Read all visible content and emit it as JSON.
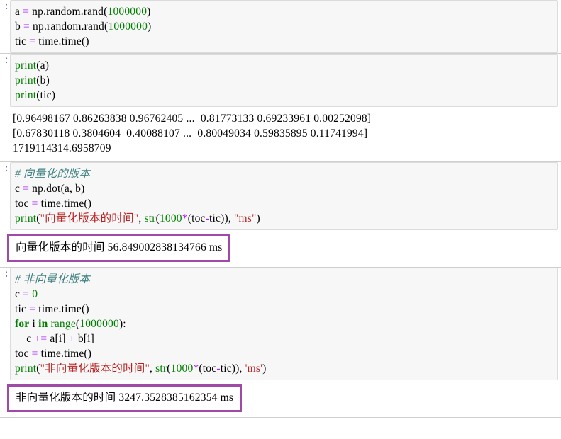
{
  "notebook": {
    "cells": [
      {
        "type": "code",
        "prompt": ":",
        "lines": [
          [
            {
              "t": "a ",
              "c": "plain"
            },
            {
              "t": "=",
              "c": "op"
            },
            {
              "t": " np.random.rand(",
              "c": "plain"
            },
            {
              "t": "1000000",
              "c": "num"
            },
            {
              "t": ")",
              "c": "plain"
            }
          ],
          [
            {
              "t": "b ",
              "c": "plain"
            },
            {
              "t": "=",
              "c": "op"
            },
            {
              "t": " np.random.rand(",
              "c": "plain"
            },
            {
              "t": "1000000",
              "c": "num"
            },
            {
              "t": ")",
              "c": "plain"
            }
          ],
          [
            {
              "t": "tic ",
              "c": "plain"
            },
            {
              "t": "=",
              "c": "op"
            },
            {
              "t": " time.time()",
              "c": "plain"
            }
          ]
        ],
        "output": null
      },
      {
        "type": "code",
        "prompt": ":",
        "lines": [
          [
            {
              "t": "print",
              "c": "builtin"
            },
            {
              "t": "(a)",
              "c": "plain"
            }
          ],
          [
            {
              "t": "print",
              "c": "builtin"
            },
            {
              "t": "(b)",
              "c": "plain"
            }
          ],
          [
            {
              "t": "print",
              "c": "builtin"
            },
            {
              "t": "(tic)",
              "c": "plain"
            }
          ]
        ],
        "output": {
          "style": "plain",
          "lines": [
            "[0.96498167 0.86263838 0.96762405 ...  0.81773133 0.69233961 0.00252098]",
            "[0.67830118 0.3804604  0.40088107 ...  0.80049034 0.59835895 0.11741994]",
            "1719114314.6958709"
          ]
        }
      },
      {
        "type": "code",
        "prompt": ":",
        "lines": [
          [
            {
              "t": "# 向量化的版本",
              "c": "cmt"
            }
          ],
          [
            {
              "t": "c ",
              "c": "plain"
            },
            {
              "t": "=",
              "c": "op"
            },
            {
              "t": " np.dot(a, b)",
              "c": "plain"
            }
          ],
          [
            {
              "t": "toc ",
              "c": "plain"
            },
            {
              "t": "=",
              "c": "op"
            },
            {
              "t": " time.time()",
              "c": "plain"
            }
          ],
          [
            {
              "t": "print",
              "c": "builtin"
            },
            {
              "t": "(",
              "c": "plain"
            },
            {
              "t": "\"向量化版本的时间\"",
              "c": "str"
            },
            {
              "t": ", ",
              "c": "plain"
            },
            {
              "t": "str",
              "c": "builtin"
            },
            {
              "t": "(",
              "c": "plain"
            },
            {
              "t": "1000",
              "c": "num"
            },
            {
              "t": "*",
              "c": "op"
            },
            {
              "t": "(toc",
              "c": "plain"
            },
            {
              "t": "-",
              "c": "op"
            },
            {
              "t": "tic)), ",
              "c": "plain"
            },
            {
              "t": "\"ms\"",
              "c": "str"
            },
            {
              "t": ")",
              "c": "plain"
            }
          ]
        ],
        "output": {
          "style": "boxed",
          "border_color": "#a04aa8",
          "lines": [
            "向量化版本的时间 56.849002838134766 ms"
          ]
        }
      },
      {
        "type": "code",
        "prompt": ":",
        "lines": [
          [
            {
              "t": "# 非向量化版本",
              "c": "cmt"
            }
          ],
          [
            {
              "t": "c ",
              "c": "plain"
            },
            {
              "t": "=",
              "c": "op"
            },
            {
              "t": " ",
              "c": "plain"
            },
            {
              "t": "0",
              "c": "num"
            }
          ],
          [
            {
              "t": "tic ",
              "c": "plain"
            },
            {
              "t": "=",
              "c": "op"
            },
            {
              "t": " time.time()",
              "c": "plain"
            }
          ],
          [
            {
              "t": "for",
              "c": "kw"
            },
            {
              "t": " i ",
              "c": "plain"
            },
            {
              "t": "in",
              "c": "kw"
            },
            {
              "t": " ",
              "c": "plain"
            },
            {
              "t": "range",
              "c": "builtin"
            },
            {
              "t": "(",
              "c": "plain"
            },
            {
              "t": "1000000",
              "c": "num"
            },
            {
              "t": "):",
              "c": "plain"
            }
          ],
          [
            {
              "t": "    c ",
              "c": "plain"
            },
            {
              "t": "+=",
              "c": "op"
            },
            {
              "t": " a[i] ",
              "c": "plain"
            },
            {
              "t": "+",
              "c": "op"
            },
            {
              "t": " b[i]",
              "c": "plain"
            }
          ],
          [
            {
              "t": "toc ",
              "c": "plain"
            },
            {
              "t": "=",
              "c": "op"
            },
            {
              "t": " time.time()",
              "c": "plain"
            }
          ],
          [
            {
              "t": "print",
              "c": "builtin"
            },
            {
              "t": "(",
              "c": "plain"
            },
            {
              "t": "\"非向量化版本的时间\"",
              "c": "str"
            },
            {
              "t": ", ",
              "c": "plain"
            },
            {
              "t": "str",
              "c": "builtin"
            },
            {
              "t": "(",
              "c": "plain"
            },
            {
              "t": "1000",
              "c": "num"
            },
            {
              "t": "*",
              "c": "op"
            },
            {
              "t": "(toc",
              "c": "plain"
            },
            {
              "t": "-",
              "c": "op"
            },
            {
              "t": "tic)), ",
              "c": "plain"
            },
            {
              "t": "'ms'",
              "c": "str"
            },
            {
              "t": ")",
              "c": "plain"
            }
          ]
        ],
        "output": {
          "style": "boxed",
          "border_color": "#a04aa8",
          "lines": [
            "非向量化版本的时间 3247.3528385162354 ms"
          ]
        }
      }
    ]
  }
}
